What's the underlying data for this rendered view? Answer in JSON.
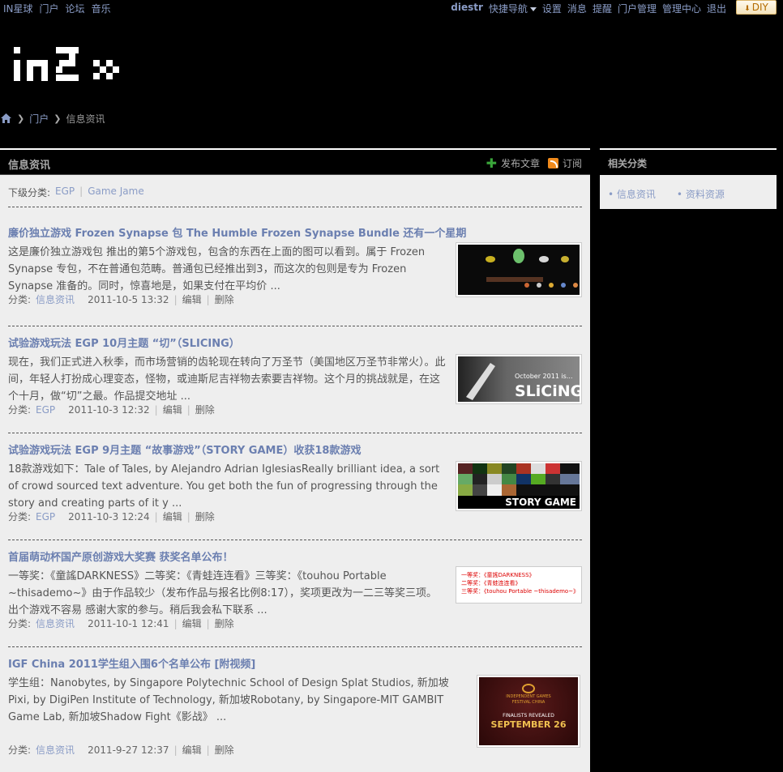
{
  "topbar": {
    "left_links": [
      "IN星球",
      "门户",
      "论坛",
      "音乐"
    ],
    "user": "diestr",
    "quick_nav": "快捷导航",
    "right_links": [
      "设置",
      "消息",
      "提醒",
      "门户管理",
      "管理中心",
      "退出"
    ],
    "diy": "DIY"
  },
  "breadcrumb": {
    "portal": "门户",
    "current": "信息资讯"
  },
  "main": {
    "title": "信息资讯",
    "publish": "发布文章",
    "subscribe": "订阅",
    "subcat_label": "下级分类:",
    "subcats": [
      "EGP",
      "Game Jame"
    ],
    "meta_label": "分类:",
    "edit": "编辑",
    "delete": "删除",
    "articles": [
      {
        "title": "廉价独立游戏 Frozen Synapse 包 The Humble Frozen Synapse Bundle 还有一个星期",
        "summary": "这是廉价独立游戏包 推出的第5个游戏包，包含的东西在上面的图可以看到。属于 Frozen Synapse 专包，不在普通包范畴。普通包已经推出到3，而这次的包则是专为 Frozen Synapse 准备的。同时，惊喜地是，如果支付在平均价 ...",
        "category": "信息资讯",
        "time": "2011-10-5 13:32"
      },
      {
        "title": "试验游戏玩法 EGP 10月主题 “切”（SLICING）",
        "summary": "现在，我们正式进入秋季，而市场营销的齿轮现在转向了万圣节（美国地区万圣节非常火）。此间，年轻人打扮成心理变态，怪物，或迪斯尼吉祥物去索要吉祥物。这个月的挑战就是，在这个十月，做“切”之最。作品提交地址 ...",
        "category": "EGP",
        "time": "2011-10-3 12:32",
        "thumb_text": [
          "October 2011 is...",
          "SLiCiNG"
        ]
      },
      {
        "title": "试验游戏玩法 EGP 9月主题 “故事游戏”（STORY GAME）收获18款游戏",
        "summary": "18款游戏如下：Tale of Tales, by Alejandro Adrian IglesiasReally brilliant idea, a sort of crowd sourced text adventure. You get both the fun of progressing through the story and creating parts of it y ...",
        "category": "EGP",
        "time": "2011-10-3 12:24",
        "thumb_text": [
          "STORY GAME"
        ]
      },
      {
        "title": "首届萌动杯国产原创游戏大奖赛 获奖名单公布！",
        "summary": "一等奖：《童謠DARKNESS》二等奖：《青蛙连连看》三等奖：《touhou Portable ~thisademo~》由于作品较少（发布作品与报名比例8:17），奖项更改为一二三等奖三项。出个游戏不容易 感谢大家的参与。稍后我会私下联系 ...",
        "category": "信息资讯",
        "time": "2011-10-1 12:41",
        "thumb_text": [
          "一等奖：《童謠DARKNESS》",
          "二等奖：《青蛙连连看》",
          "三等奖：《touhou Portable ~thisademo~》"
        ]
      },
      {
        "title": "IGF China 2011学生组入围6个名单公布 [附视频]",
        "summary": "学生组：Nanobytes, by Singapore Polytechnic School of Design Splat Studios, 新加坡Pixi, by DigiPen Institute of Technology, 新加坡Robotany, by Singapore-MIT GAMBIT Game Lab, 新加坡Shadow Fight《影战》 ...",
        "category": "信息资讯",
        "time": "2011-9-27 12:37",
        "thumb_text": [
          "INDEPENDENT GAMES",
          "FESTIVAL CHINA",
          "FINALISTS REVEALED",
          "SEPTEMBER 26"
        ]
      }
    ]
  },
  "sidebar": {
    "title": "相关分类",
    "items": [
      "信息资讯",
      "资料资源"
    ]
  },
  "colors": {
    "link": "#8a9cc6",
    "title_link": "#6b7fb0",
    "panel_bg": "#eeeeee",
    "page_bg": "#000000"
  }
}
